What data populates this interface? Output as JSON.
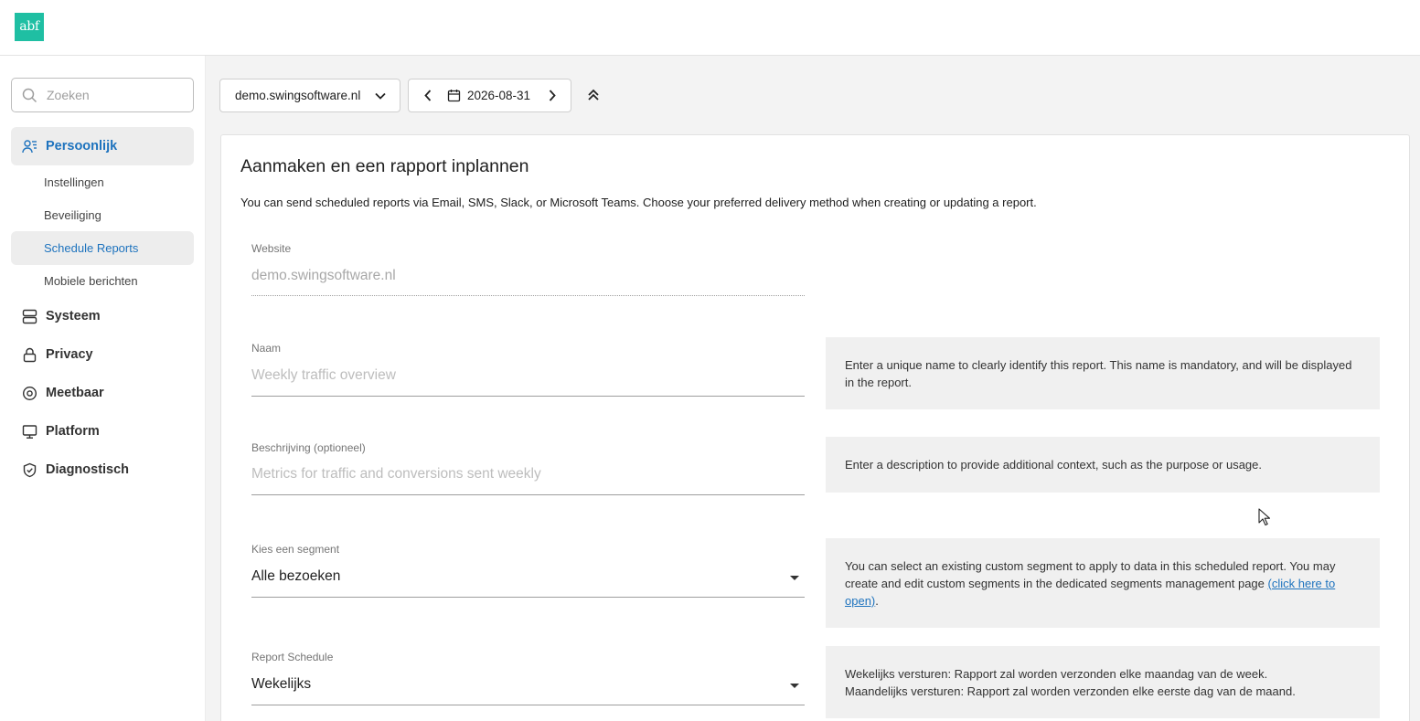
{
  "logo": {
    "text": "abf"
  },
  "search": {
    "placeholder": "Zoeken"
  },
  "sidebar": {
    "personal": "Persoonlijk",
    "settings": "Instellingen",
    "security": "Beveiliging",
    "schedule_reports": "Schedule Reports",
    "mobile_messages": "Mobiele berichten",
    "system": "Systeem",
    "privacy": "Privacy",
    "measurable": "Meetbaar",
    "platform": "Platform",
    "diagnostic": "Diagnostisch"
  },
  "toolbar": {
    "site_selector": "demo.swingsoftware.nl",
    "date": "2026-08-31"
  },
  "card": {
    "title": "Aanmaken en een rapport inplannen",
    "intro": "You can send scheduled reports via Email, SMS, Slack, or Microsoft Teams. Choose your preferred delivery method when creating or updating a report."
  },
  "form": {
    "website": {
      "label": "Website",
      "value": "demo.swingsoftware.nl"
    },
    "name": {
      "label": "Naam",
      "placeholder": "Weekly traffic overview",
      "help": "Enter a unique name to clearly identify this report. This name is mandatory, and will be displayed in the report."
    },
    "description": {
      "label": "Beschrijving (optioneel)",
      "placeholder": "Metrics for traffic and conversions sent weekly",
      "help": "Enter a description to provide additional context, such as the purpose or usage."
    },
    "segment": {
      "label": "Kies een segment",
      "value": "Alle bezoeken",
      "help": "You can select an existing custom segment to apply to data in this scheduled report. You may create and edit custom segments in the dedicated segments management page ",
      "help_link": "(click here to open)",
      "help_end": "."
    },
    "schedule": {
      "label": "Report Schedule",
      "value": "Wekelijks",
      "help_weekly": "Wekelijks versturen: Rapport zal worden verzonden elke maandag van de week.",
      "help_monthly": "Maandelijks versturen: Rapport zal worden verzonden elke eerste dag van de maand."
    }
  },
  "colors": {
    "accent": "#1e73be",
    "logo": "#1fbfa3"
  }
}
